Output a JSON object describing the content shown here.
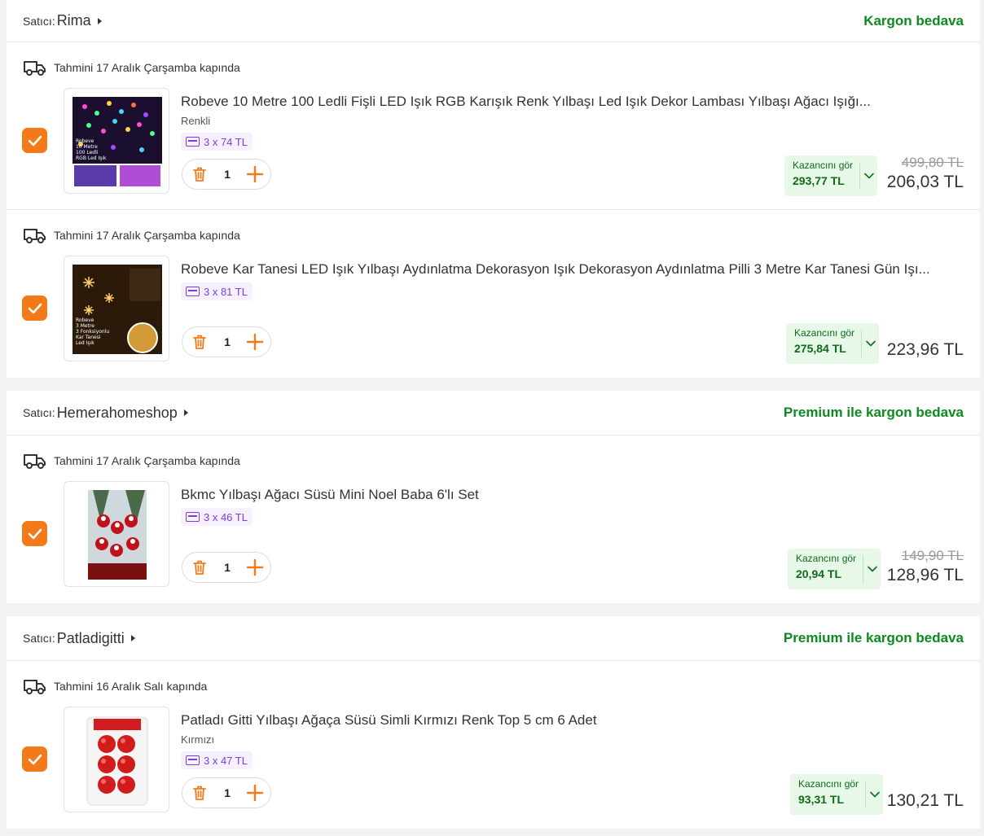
{
  "sellers": [
    {
      "prefix": "Satıcı:",
      "name": "Rima",
      "shipping": "Kargon bedava",
      "items": [
        {
          "delivery": "Tahmini 17 Aralık Çarşamba kapında",
          "title": "Robeve 10 Metre 100 Ledli Fişli LED Işık RGB Karışık Renk Yılbaşı Led Işık Dekor Lambası Yılbaşı Ağacı Işığı...",
          "variant": "Renkli",
          "installment": "3 x 74 TL",
          "quantity": "1",
          "earn_label": "Kazancını gör",
          "earn_amount": "293,77 TL",
          "old_price": "499,80 TL",
          "price": "206,03 TL"
        },
        {
          "delivery": "Tahmini 17 Aralık Çarşamba kapında",
          "title": "Robeve Kar Tanesi LED Işık Yılbaşı Aydınlatma Dekorasyon Işık Dekorasyon Aydınlatma Pilli 3 Metre Kar Tanesi Gün Işı...",
          "variant": "",
          "installment": "3 x 81 TL",
          "quantity": "1",
          "earn_label": "Kazancını gör",
          "earn_amount": "275,84 TL",
          "old_price": "",
          "price": "223,96 TL"
        }
      ]
    },
    {
      "prefix": "Satıcı:",
      "name": "Hemerahomeshop",
      "shipping": "Premium ile kargon bedava",
      "items": [
        {
          "delivery": "Tahmini 17 Aralık Çarşamba kapında",
          "title": "Bkmc Yılbaşı Ağacı Süsü Mini Noel Baba 6'lı Set",
          "variant": "",
          "installment": "3 x 46 TL",
          "quantity": "1",
          "earn_label": "Kazancını gör",
          "earn_amount": "20,94 TL",
          "old_price": "149,90 TL",
          "price": "128,96 TL"
        }
      ]
    },
    {
      "prefix": "Satıcı:",
      "name": "Patladigitti",
      "shipping": "Premium ile kargon bedava",
      "items": [
        {
          "delivery": "Tahmini 16 Aralık Salı kapında",
          "title": "Patladı Gitti Yılbaşı Ağaça Süsü Simli Kırmızı Renk Top 5 cm 6 Adet",
          "variant": "Kırmızı",
          "installment": "3 x 47 TL",
          "quantity": "1",
          "earn_label": "Kazancını gör",
          "earn_amount": "93,31 TL",
          "old_price": "",
          "price": "130,21 TL"
        }
      ]
    }
  ],
  "thumb_text": {
    "led_lines": [
      "Robeve",
      "10 Metre",
      "100 Ledli",
      "RGB Led Işık"
    ],
    "snow_lines": [
      "Robeve",
      "3 Metre",
      "3 Fonksiyonlu",
      "Kar Tanesi",
      "Led Işık"
    ]
  },
  "colors": {
    "accent": "#f27a1a",
    "success": "#0d8a1f",
    "installment": "#7b3fd8"
  }
}
